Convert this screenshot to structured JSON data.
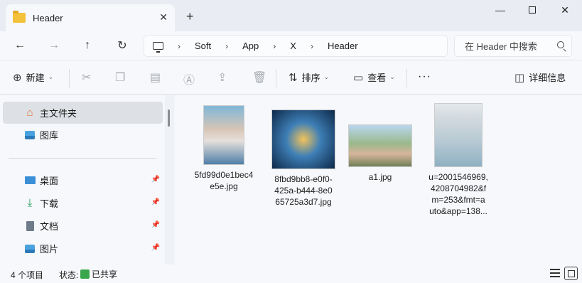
{
  "tab": {
    "title": "Header"
  },
  "window": {
    "min": "—",
    "close": "✕"
  },
  "address": {
    "crumbs": [
      "Soft",
      "App",
      "X",
      "Header"
    ],
    "sep": "›"
  },
  "search": {
    "placeholder": "在 Header 中搜索"
  },
  "toolbar": {
    "new_label": "新建",
    "sort_label": "排序",
    "view_label": "查看",
    "more": "···",
    "details_label": "详细信息"
  },
  "sidebar": {
    "items": [
      {
        "label": "主文件夹",
        "icon": "home-icon"
      },
      {
        "label": "图库",
        "icon": "gallery-icon"
      },
      {
        "label": "桌面",
        "icon": "desktop-icon",
        "pinned": true
      },
      {
        "label": "下载",
        "icon": "download-icon",
        "pinned": true
      },
      {
        "label": "文档",
        "icon": "document-icon",
        "pinned": true
      },
      {
        "label": "图片",
        "icon": "pictures-icon",
        "pinned": true
      }
    ]
  },
  "files": [
    {
      "name_lines": [
        "5fd99d0e1bec4",
        "e5e.jpg"
      ]
    },
    {
      "name_lines": [
        "8fbd9bb8-e0f0-",
        "425a-b444-8e0",
        "65725a3d7.jpg"
      ]
    },
    {
      "name_lines": [
        "a1.jpg"
      ]
    },
    {
      "name_lines": [
        "u=2001546969,",
        "4208704982&f",
        "m=253&fmt=a",
        "uto&app=138..."
      ]
    }
  ],
  "status": {
    "count": "4 个项目",
    "state_label": "状态:",
    "share_label": "已共享"
  },
  "colors": {
    "accent": "#0067c0",
    "folder": "#f3c13a",
    "share": "#3aa64c"
  }
}
